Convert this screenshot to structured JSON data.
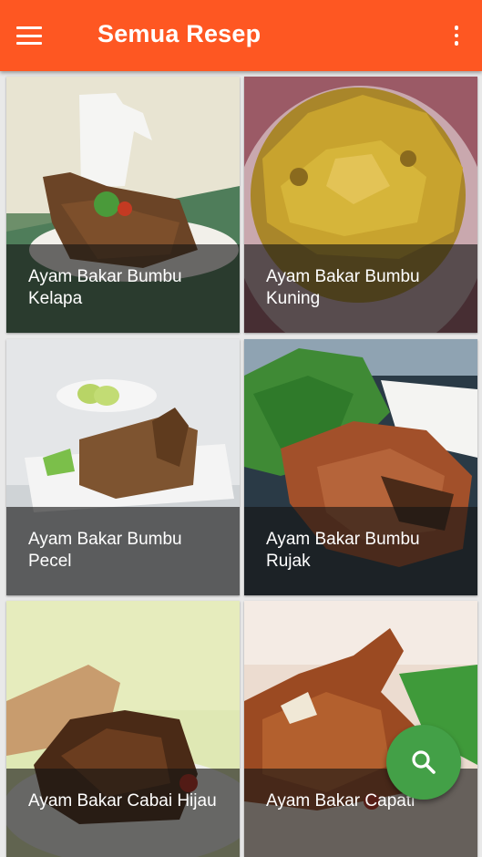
{
  "appbar": {
    "title": "Semua Resep",
    "menu_icon": "hamburger-menu-icon",
    "overflow_icon": "more-vert-icon",
    "background": "#fe5722"
  },
  "recipes": [
    {
      "line1": "Ayam Bakar Bumbu",
      "line2": "Kelapa"
    },
    {
      "line1": "Ayam Bakar Bumbu",
      "line2": "Kuning"
    },
    {
      "line1": "Ayam Bakar Bumbu",
      "line2": "Pecel"
    },
    {
      "line1": "Ayam Bakar Bumbu",
      "line2": "Rujak"
    },
    {
      "line1": "Ayam Bakar Cabai Hijau",
      "line2": ""
    },
    {
      "line1": "Ayam Bakar Capati",
      "line2": ""
    }
  ],
  "fab": {
    "icon": "search-icon",
    "color": "#43a047"
  }
}
